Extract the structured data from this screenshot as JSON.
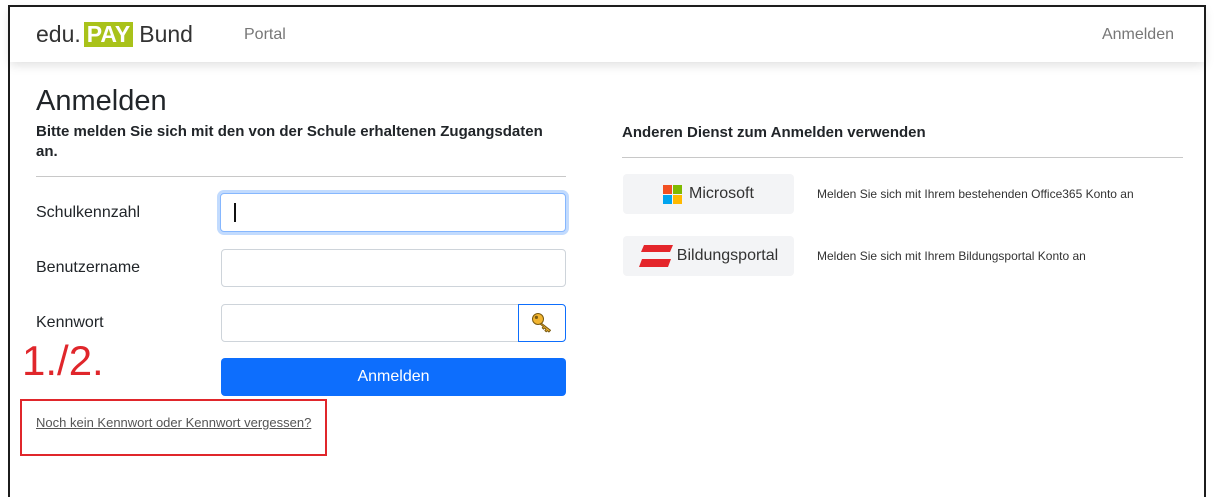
{
  "brand": {
    "prefix": "edu.",
    "badge": "PAY",
    "suffix": "Bund"
  },
  "nav": {
    "portal_label": "Portal",
    "login_label": "Anmelden"
  },
  "login": {
    "title": "Anmelden",
    "instructions": "Bitte melden Sie sich mit den von der Schule erhaltenen Zugangsdaten an.",
    "fields": [
      {
        "label": "Schulkennzahl",
        "value": "",
        "focused": true
      },
      {
        "label": "Benutzername",
        "value": ""
      },
      {
        "label": "Kennwort",
        "value": "",
        "action_icon": "key-icon"
      }
    ],
    "submit_label": "Anmelden",
    "forgot_password_link": "Noch kein Kennwort oder Kennwort vergessen?"
  },
  "external_login": {
    "heading": "Anderen Dienst zum Anmelden verwenden",
    "providers": [
      {
        "label": "Microsoft",
        "icon": "microsoft-logo-icon",
        "description": "Melden Sie sich mit Ihrem bestehenden Office365 Konto an"
      },
      {
        "label": "Bildungsportal",
        "icon": "bildungsportal-logo-icon",
        "description": "Melden Sie sich mit Ihrem Bildungsportal Konto an"
      }
    ]
  },
  "annotation": {
    "step_label": "1./2."
  },
  "colors": {
    "accent": "#0d6efd",
    "brand_badge": "#a9c21a",
    "annotation": "#e0262b",
    "text": "#212529"
  }
}
